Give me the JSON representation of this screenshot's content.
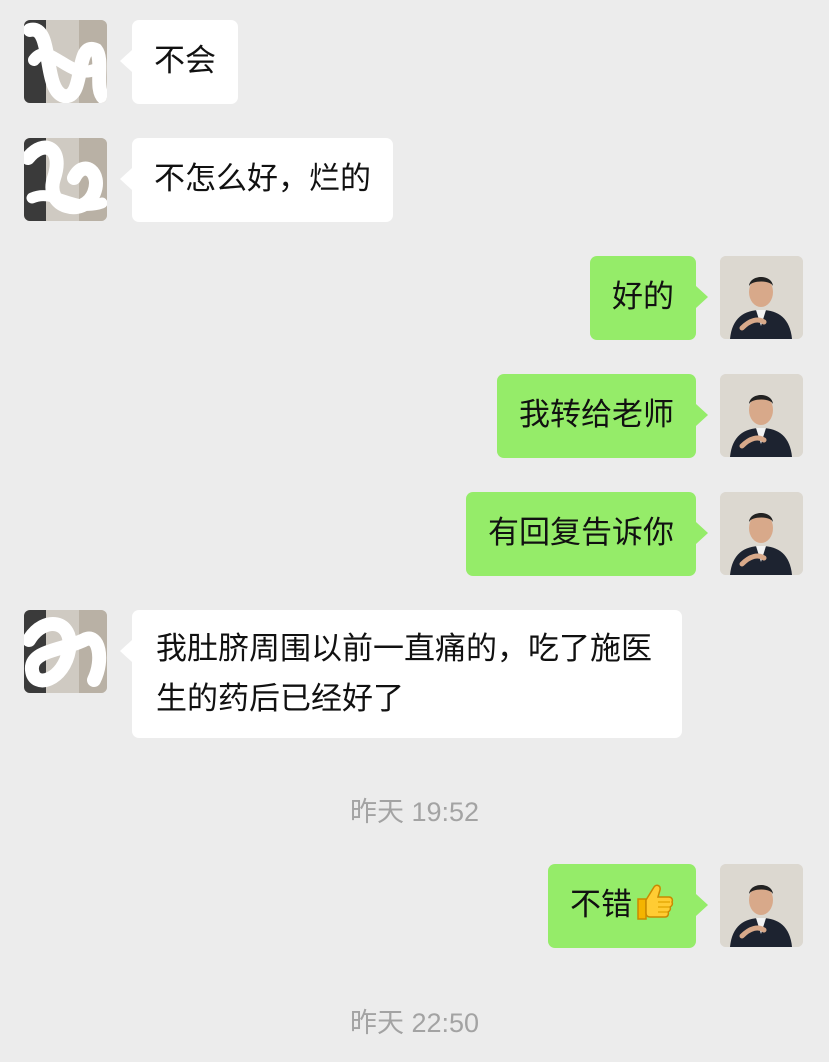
{
  "chat": {
    "messages": [
      {
        "side": "in",
        "text": "不会"
      },
      {
        "side": "in",
        "text": "不怎么好，烂的"
      },
      {
        "side": "out",
        "text": "好的"
      },
      {
        "side": "out",
        "text": "我转给老师"
      },
      {
        "side": "out",
        "text": "有回复告诉你"
      },
      {
        "side": "in",
        "text": "我肚脐周围以前一直痛的，吃了施医生的药后已经好了"
      },
      {
        "side": "out",
        "text": "不错",
        "emoji": "thumbs-up"
      }
    ],
    "timestamps": [
      "昨天 19:52",
      "昨天 22:50"
    ]
  },
  "colors": {
    "background": "#ececec",
    "incoming_bubble": "#ffffff",
    "outgoing_bubble": "#95ec69",
    "timestamp_text": "#a3a3a3"
  }
}
